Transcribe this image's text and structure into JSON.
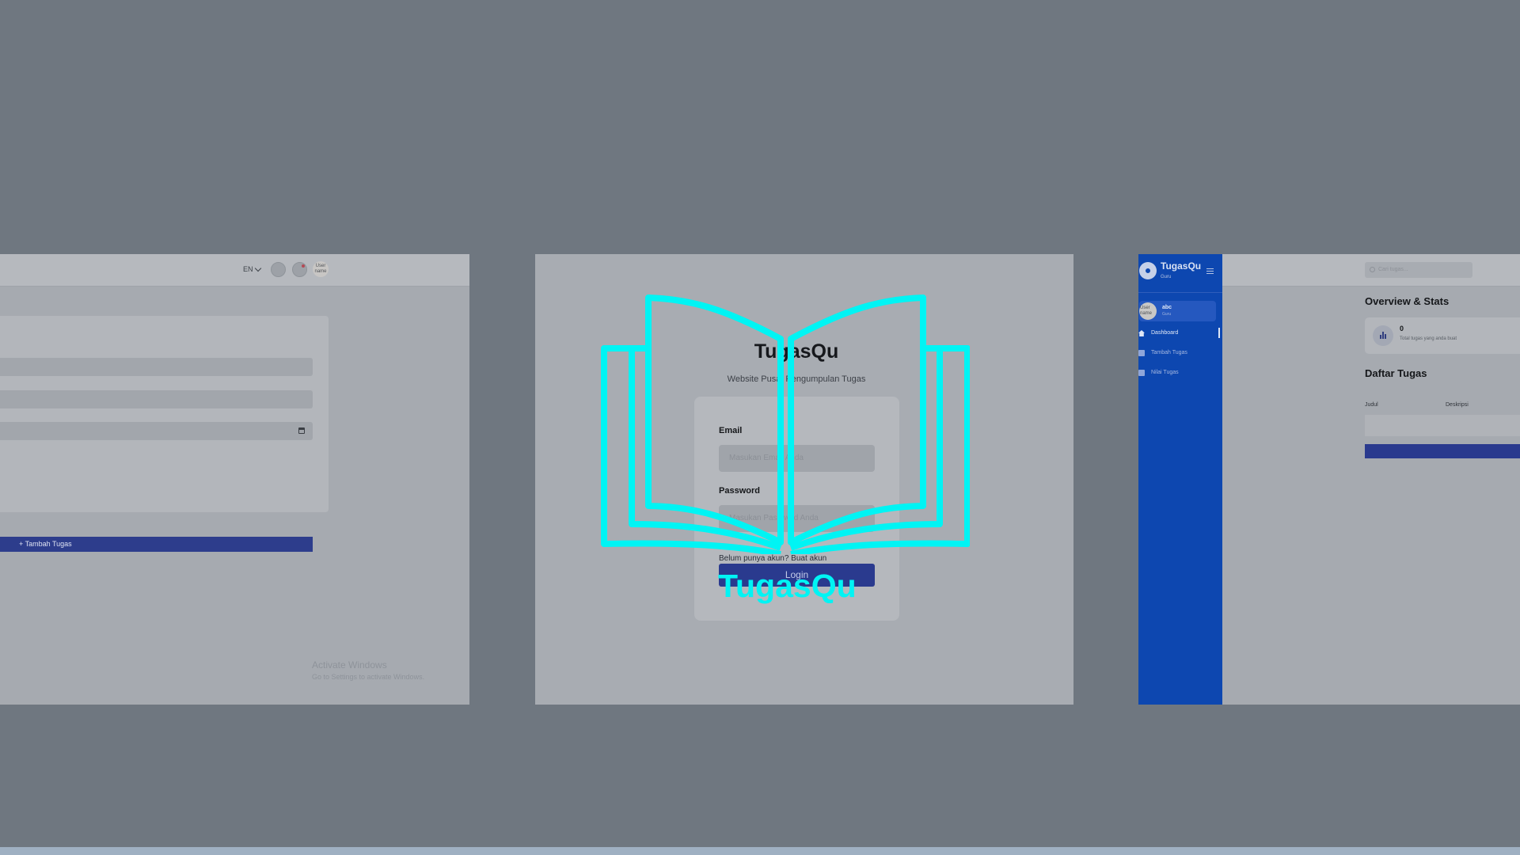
{
  "left_panel": {
    "language": "EN",
    "avatar_text": "User name",
    "add_button_label": "+ Tambah Tugas",
    "watermark_title": "Activate Windows",
    "watermark_sub": "Go to Settings to activate Windows."
  },
  "center_panel": {
    "title": "TugasQu",
    "subtitle": "Website Pusat Pengumpulan Tugas",
    "email_label": "Email",
    "email_placeholder": "Masukan Email Anda",
    "password_label": "Password",
    "password_placeholder": "Masukan Password Anda",
    "register_text": "Belum punya akun? Buat akun",
    "login_label": "Login"
  },
  "logo": {
    "text": "TugasQu",
    "icon": "open-book-icon",
    "color": "#00f4f4"
  },
  "right_panel": {
    "sidebar": {
      "title": "TugasQu",
      "role": "Guru",
      "user_name": "abc",
      "user_role": "Guru",
      "avatar_text": "User name",
      "items": [
        {
          "label": "Dashboard",
          "icon": "home-icon",
          "active": true
        },
        {
          "label": "Tambah Tugas",
          "icon": "calendar-icon",
          "active": false
        },
        {
          "label": "Nilai Tugas",
          "icon": "grade-icon",
          "active": false
        }
      ]
    },
    "search_placeholder": "Cari tugas...",
    "overview_title": "Overview & Stats",
    "stat_value": "0",
    "stat_label": "Total tugas yang anda buat",
    "list_title": "Daftar Tugas",
    "columns": [
      "Judul",
      "Deskripsi"
    ]
  },
  "colors": {
    "backdrop": "#6f7780",
    "sidebar": "#0d47b0",
    "primary_button": "#2a3a8e",
    "logo_accent": "#00f4f4"
  }
}
